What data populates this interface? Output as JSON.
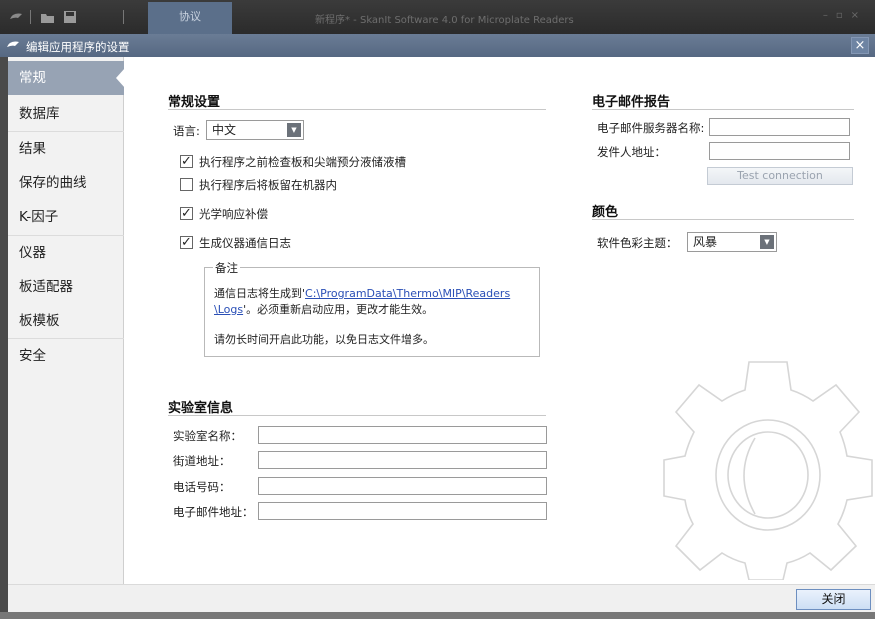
{
  "app": {
    "tab_label": "协议",
    "title": "新程序* - SkanIt Software 4.0 for Microplate Readers"
  },
  "dialog": {
    "title": "编辑应用程序的设置",
    "close_glyph": "×",
    "close_button": "关闭"
  },
  "sidebar": {
    "items": [
      {
        "label": "常规"
      },
      {
        "label": "数据库"
      },
      {
        "label": "结果"
      },
      {
        "label": "保存的曲线"
      },
      {
        "label": "K-因子"
      },
      {
        "label": "仪器"
      },
      {
        "label": "板适配器"
      },
      {
        "label": "板模板"
      },
      {
        "label": "安全"
      }
    ]
  },
  "general": {
    "title": "常规设置",
    "language_label": "语言:",
    "language_value": "中文",
    "checks": [
      {
        "label": "执行程序之前检查板和尖端预分液储液槽",
        "checked": true
      },
      {
        "label": "执行程序后将板留在机器内",
        "checked": false
      },
      {
        "label": "光学响应补偿",
        "checked": true
      },
      {
        "label": "生成仪器通信日志",
        "checked": true
      }
    ],
    "note": {
      "legend": "备注",
      "line1_prefix": "通信日志将生成到'",
      "line1_link": "C:\\ProgramData\\Thermo\\MIP\\Readers",
      "line2_link": "\\Logs",
      "line2_suffix": "'。必须重新启动应用，更改才能生效。",
      "line3": "请勿长时间开启此功能，以免日志文件增多。"
    }
  },
  "lab": {
    "title": "实验室信息",
    "fields": [
      {
        "label": "实验室名称：",
        "value": ""
      },
      {
        "label": "街道地址：",
        "value": ""
      },
      {
        "label": "电话号码：",
        "value": ""
      },
      {
        "label": "电子邮件地址：",
        "value": ""
      }
    ]
  },
  "email": {
    "title": "电子邮件报告",
    "server_label": "电子邮件服务器名称:",
    "server_value": "",
    "sender_label": "发件人地址：",
    "sender_value": "",
    "test_button": "Test connection"
  },
  "color": {
    "title": "颜色",
    "theme_label": "软件色彩主题：",
    "theme_value": "风暴"
  },
  "colors": {
    "nav_active": "#97a3b4",
    "link": "#2a4fb6",
    "dialog_titlebar": "#566882"
  }
}
